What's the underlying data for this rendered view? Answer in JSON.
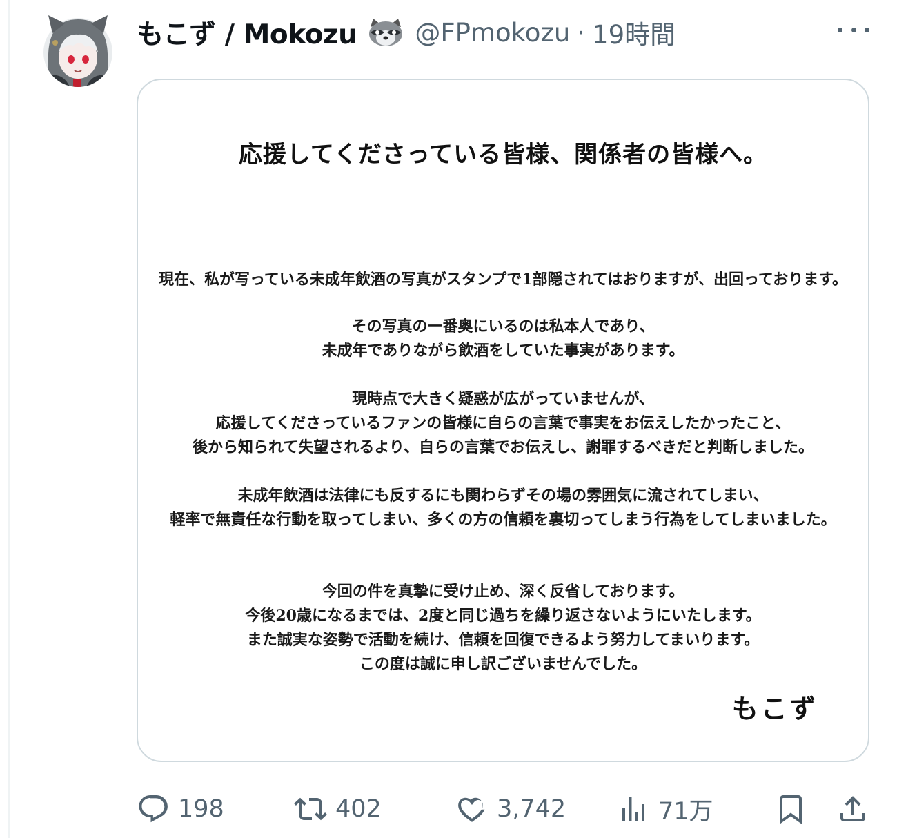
{
  "tweet": {
    "display_name": "もこず / Mokozu",
    "handle": "@FPmokozu",
    "separator": "·",
    "time": "19時間",
    "name_emoji_icon": "raccoon-icon",
    "avatar_icon": "avatar-anime-character",
    "more_icon": "more-horizontal-icon"
  },
  "statement": {
    "title": "応援してくださっている皆様、関係者の皆様へ。",
    "paragraphs": [
      [
        "現在、私が写っている未成年飲酒の写真がスタンプで1部隠されてはおりますが、出回っております。"
      ],
      [
        "その写真の一番奥にいるのは私本人であり、",
        "未成年でありながら飲酒をしていた事実があります。"
      ],
      [
        "現時点で大きく疑惑が広がっていませんが、",
        "応援してくださっているファンの皆様に自らの言葉で事実をお伝えしたかったこと、",
        "後から知られて失望されるより、自らの言葉でお伝えし、謝罪するべきだと判断しました。"
      ],
      [
        "未成年飲酒は法律にも反するにも関わらずその場の雰囲気に流されてしまい、",
        "軽率で無責任な行動を取ってしまい、多くの方の信頼を裏切ってしまう行為をしてしまいました。"
      ],
      [
        "今回の件を真摯に受け止め、深く反省しております。",
        "今後20歳になるまでは、2度と同じ過ちを繰り返さないようにいたします。",
        "また誠実な姿勢で活動を続け、信頼を回復できるよう努力してまいります。",
        "この度は誠に申し訳ございませんでした。"
      ]
    ],
    "signature": "もこず"
  },
  "actions": {
    "reply_count": "198",
    "retweet_count": "402",
    "like_count": "3,742",
    "views_count": "71万",
    "icons": [
      "reply-icon",
      "retweet-icon",
      "like-icon",
      "views-icon",
      "bookmark-icon",
      "share-icon"
    ]
  },
  "colors": {
    "text_primary": "#0f1419",
    "text_secondary": "#536471",
    "border": "#cfd9de"
  }
}
